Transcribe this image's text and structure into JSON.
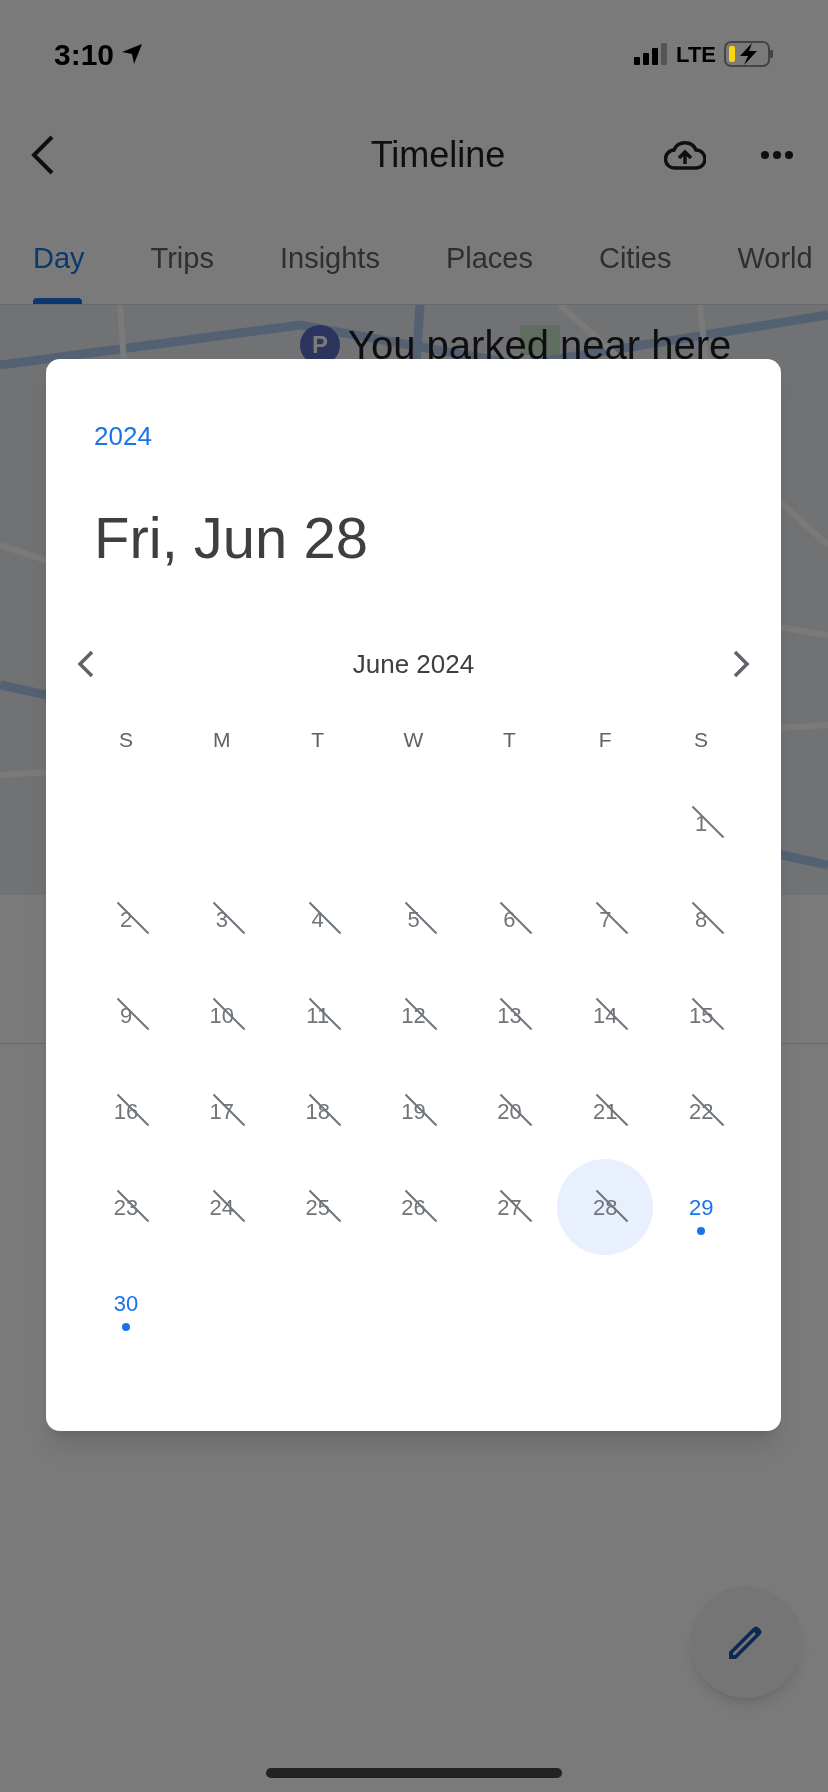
{
  "status_bar": {
    "time": "3:10",
    "network": "LTE"
  },
  "header": {
    "title": "Timeline"
  },
  "tabs": [
    {
      "label": "Day",
      "selected": true
    },
    {
      "label": "Trips",
      "selected": false
    },
    {
      "label": "Insights",
      "selected": false
    },
    {
      "label": "Places",
      "selected": false
    },
    {
      "label": "Cities",
      "selected": false
    },
    {
      "label": "World",
      "selected": false
    }
  ],
  "map": {
    "pin_letter": "P",
    "label": "You parked near here"
  },
  "date_picker": {
    "year": "2024",
    "selected_date": "Fri, Jun 28",
    "month": "June 2024",
    "weekdays": [
      "S",
      "M",
      "T",
      "W",
      "T",
      "F",
      "S"
    ],
    "weeks": [
      {
        "days": [
          {
            "label": "1",
            "disabled": true,
            "selected": false,
            "has_data": false
          }
        ]
      },
      {
        "days": [
          {
            "label": "2",
            "disabled": true,
            "selected": false,
            "has_data": false
          },
          {
            "label": "3",
            "disabled": true,
            "selected": false,
            "has_data": false
          },
          {
            "label": "4",
            "disabled": true,
            "selected": false,
            "has_data": false
          },
          {
            "label": "5",
            "disabled": true,
            "selected": false,
            "has_data": false
          },
          {
            "label": "6",
            "disabled": true,
            "selected": false,
            "has_data": false
          },
          {
            "label": "7",
            "disabled": true,
            "selected": false,
            "has_data": false
          },
          {
            "label": "8",
            "disabled": true,
            "selected": false,
            "has_data": false
          }
        ]
      },
      {
        "days": [
          {
            "label": "9",
            "disabled": true,
            "selected": false,
            "has_data": false
          },
          {
            "label": "10",
            "disabled": true,
            "selected": false,
            "has_data": false
          },
          {
            "label": "11",
            "disabled": true,
            "selected": false,
            "has_data": false
          },
          {
            "label": "12",
            "disabled": true,
            "selected": false,
            "has_data": false
          },
          {
            "label": "13",
            "disabled": true,
            "selected": false,
            "has_data": false
          },
          {
            "label": "14",
            "disabled": true,
            "selected": false,
            "has_data": false
          },
          {
            "label": "15",
            "disabled": true,
            "selected": false,
            "has_data": false
          }
        ]
      },
      {
        "days": [
          {
            "label": "16",
            "disabled": true,
            "selected": false,
            "has_data": false
          },
          {
            "label": "17",
            "disabled": true,
            "selected": false,
            "has_data": false
          },
          {
            "label": "18",
            "disabled": true,
            "selected": false,
            "has_data": false
          },
          {
            "label": "19",
            "disabled": true,
            "selected": false,
            "has_data": false
          },
          {
            "label": "20",
            "disabled": true,
            "selected": false,
            "has_data": false
          },
          {
            "label": "21",
            "disabled": true,
            "selected": false,
            "has_data": false
          },
          {
            "label": "22",
            "disabled": true,
            "selected": false,
            "has_data": false
          }
        ]
      },
      {
        "days": [
          {
            "label": "23",
            "disabled": true,
            "selected": false,
            "has_data": false
          },
          {
            "label": "24",
            "disabled": true,
            "selected": false,
            "has_data": false
          },
          {
            "label": "25",
            "disabled": true,
            "selected": false,
            "has_data": false
          },
          {
            "label": "26",
            "disabled": true,
            "selected": false,
            "has_data": false
          },
          {
            "label": "27",
            "disabled": true,
            "selected": false,
            "has_data": false
          },
          {
            "label": "28",
            "disabled": true,
            "selected": true,
            "has_data": false
          },
          {
            "label": "29",
            "disabled": false,
            "selected": false,
            "has_data": true
          }
        ]
      },
      {
        "days": [
          {
            "label": "30",
            "disabled": false,
            "selected": false,
            "has_data": true
          }
        ]
      }
    ]
  }
}
